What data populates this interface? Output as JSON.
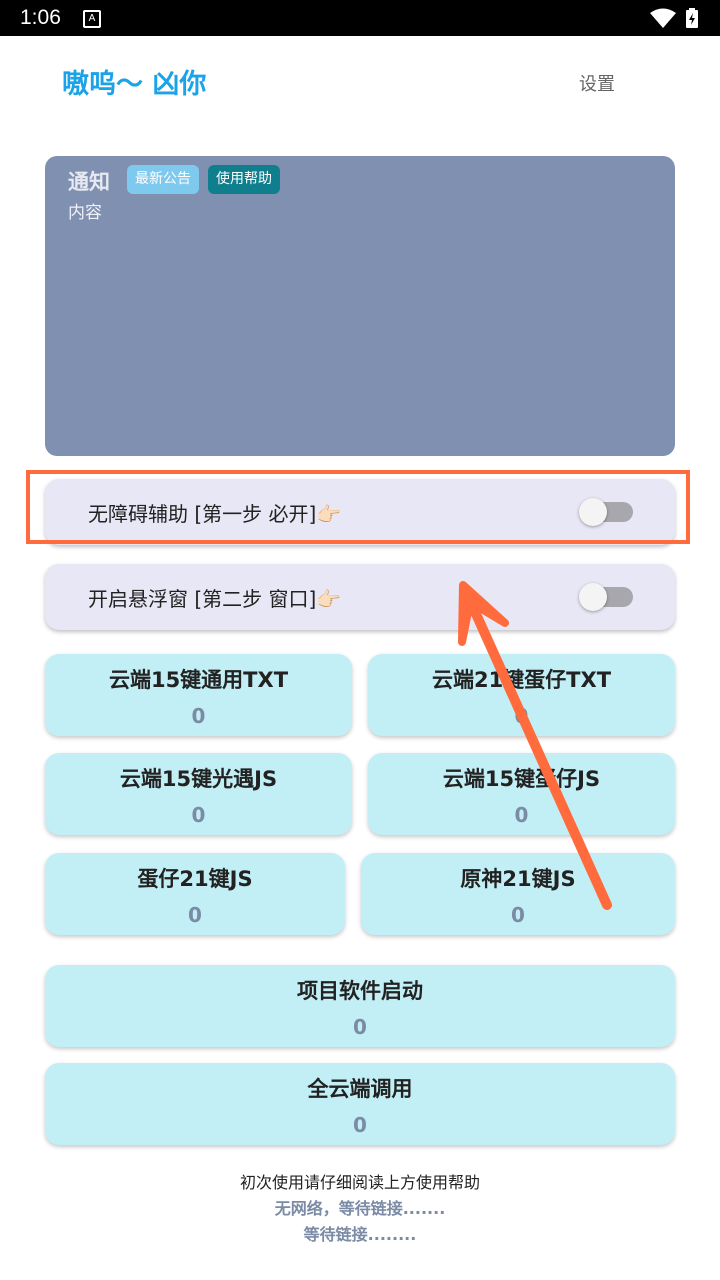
{
  "status_bar": {
    "time": "1:06",
    "notification_icon": "A"
  },
  "header": {
    "title": "嗷呜～ 凶你",
    "settings_label": "设置"
  },
  "notice": {
    "title": "通知",
    "badge_latest": "最新公告",
    "badge_help": "使用帮助",
    "content": "内容"
  },
  "toggles": [
    {
      "label": "无障碍辅助  [第一步 必开]👉🏻",
      "on": false
    },
    {
      "label": "开启悬浮窗  [第二步 窗口]👉🏻",
      "on": false
    }
  ],
  "tiles": [
    {
      "name": "云端15键通用TXT",
      "count": "0"
    },
    {
      "name": "云端21键蛋仔TXT",
      "count": "0"
    },
    {
      "name": "云端15键光遇JS",
      "count": "0"
    },
    {
      "name": "云端15键蛋仔JS",
      "count": "0"
    },
    {
      "name": "蛋仔21键JS",
      "count": "0"
    },
    {
      "name": "原神21键JS",
      "count": "0"
    },
    {
      "name": "项目软件启动",
      "count": "0"
    },
    {
      "name": "全云端调用",
      "count": "0"
    }
  ],
  "footer": {
    "line1": "初次使用请仔细阅读上方使用帮助",
    "line2": "无网络，等待链接.......",
    "line3": "等待链接........"
  },
  "colors": {
    "accent": "#1aa3e8",
    "notice_bg": "#8090b0",
    "highlight": "#ff6b3d",
    "tile_bg": "#c2eff5",
    "toggle_bg": "#e8e7f5"
  }
}
